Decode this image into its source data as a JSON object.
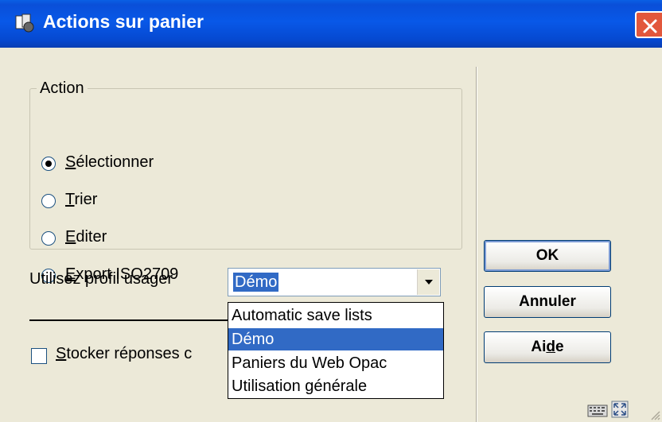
{
  "window": {
    "title": "Actions sur panier",
    "colors": {
      "titlebar": "#0a58e0",
      "close": "#e2573c",
      "face": "#ece9d8",
      "selection": "#316ac5"
    }
  },
  "action_group": {
    "legend": "Action",
    "options": [
      {
        "label_mnemonic": "S",
        "label_rest": "électionner",
        "checked": true
      },
      {
        "label_mnemonic": "T",
        "label_rest": "rier",
        "checked": false
      },
      {
        "label_mnemonic": "E",
        "label_rest": "diter",
        "checked": false
      },
      {
        "label_mnemonic": "E",
        "label_rest": "xport ISO2709",
        "checked": false
      }
    ]
  },
  "profile": {
    "label": "Utilisez profil usager",
    "selected": "Démo",
    "options": [
      "Automatic save lists",
      "Démo",
      "Paniers du Web Opac",
      "Utilisation générale"
    ]
  },
  "store": {
    "label_mnemonic": "S",
    "label_rest": "tocker réponses c",
    "checked": false
  },
  "buttons": {
    "ok": "OK",
    "cancel": "Annuler",
    "help_pre": "Ai",
    "help_mnemonic": "d",
    "help_post": "e"
  },
  "icons": [
    "app-icon",
    "close-icon",
    "keyboard-icon",
    "fullscreen-icon",
    "resize-grip-icon"
  ]
}
